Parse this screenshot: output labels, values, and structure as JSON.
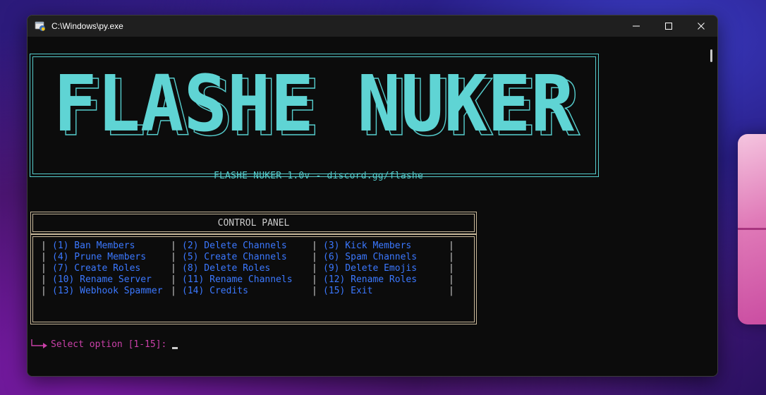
{
  "window": {
    "title": "C:\\Windows\\py.exe"
  },
  "banner": {
    "logo_text": "FLASHE NUKER",
    "subtitle": "FLASHE NUKER 1.0v - discord.gg/flashe"
  },
  "control_panel": {
    "title": "CONTROL PANEL",
    "rows": [
      [
        "(1) Ban Members",
        "(2) Delete Channels",
        "(3) Kick Members"
      ],
      [
        "(4) Prune Members",
        "(5) Create Channels",
        "(6) Spam Channels"
      ],
      [
        "(7) Create Roles",
        "(8) Delete Roles",
        "(9) Delete Emojis"
      ],
      [
        "(10) Rename Server",
        "(11) Rename Channels",
        "(12) Rename Roles"
      ],
      [
        "(13) Webhook Spammer",
        "(14) Credits",
        "(15) Exit"
      ]
    ]
  },
  "prompt": {
    "text": "Select option [1-15]:"
  },
  "colors": {
    "cyan": "#55cccc",
    "blue": "#3b78ff",
    "magenta": "#c940a8",
    "border": "#c8b89a"
  }
}
